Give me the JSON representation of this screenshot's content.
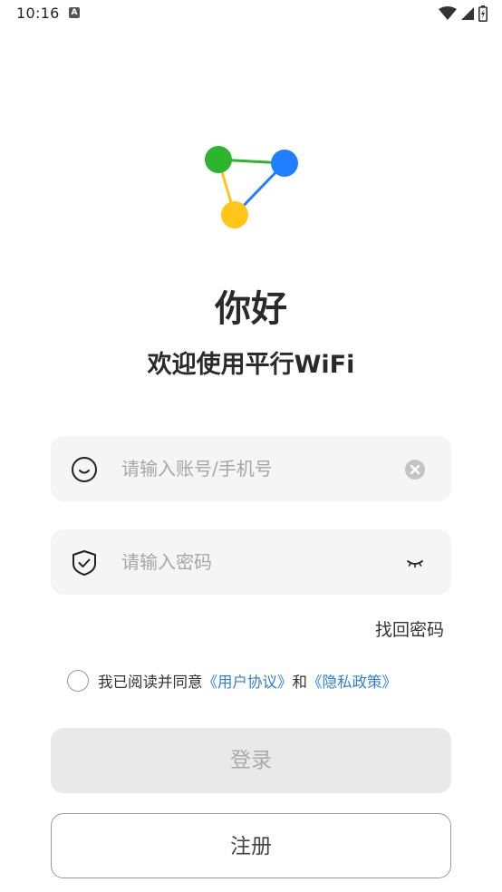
{
  "status_bar": {
    "time": "10:16",
    "notification_icon": "a-notification-icon",
    "icons": [
      "wifi-signal-icon",
      "cell-signal-icon",
      "battery-charging-icon"
    ]
  },
  "logo": {
    "icon": "network-nodes-logo",
    "colors": [
      "#2db52d",
      "#1f7fff",
      "#ffc61a"
    ]
  },
  "greeting": "你好",
  "welcome": "欢迎使用平行WiFi",
  "account": {
    "placeholder": "请输入账号/手机号",
    "value": "",
    "lead_icon": "face-icon",
    "clear_icon": "clear-icon"
  },
  "password": {
    "placeholder": "请输入密码",
    "value": "",
    "lead_icon": "shield-check-icon",
    "toggle_icon": "eye-closed-icon"
  },
  "forgot_password": "找回密码",
  "agreement": {
    "prefix": "我已阅读并同意",
    "user_agreement": "《用户协议》",
    "joiner": "和",
    "privacy_policy": "《隐私政策》",
    "checked": false,
    "link_color": "#2f7fd6"
  },
  "buttons": {
    "login": "登录",
    "register": "注册"
  }
}
